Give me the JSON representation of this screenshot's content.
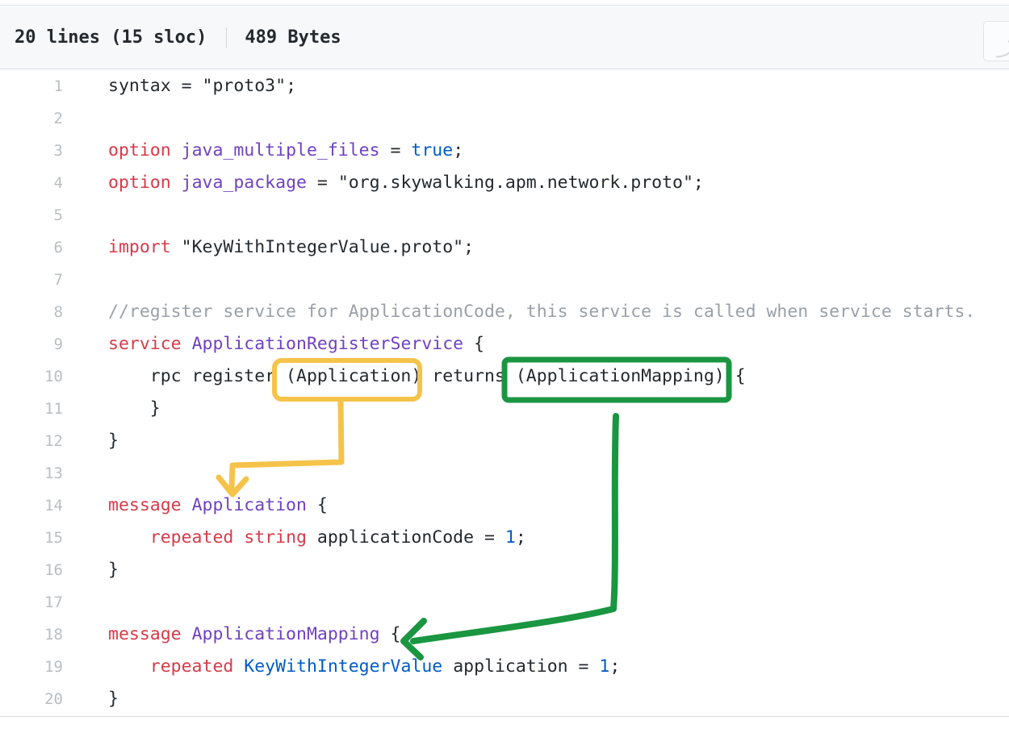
{
  "header": {
    "lines_label": "20 lines (15 sloc)",
    "bytes_label": "489 Bytes",
    "action_glyph": "⤴"
  },
  "code": {
    "language": "protobuf",
    "lines": [
      {
        "n": "1",
        "tokens": [
          {
            "t": "syntax",
            "c": "p"
          },
          {
            "t": " = ",
            "c": "p"
          },
          {
            "t": "\"proto3\"",
            "c": "s"
          },
          {
            "t": ";",
            "c": "p"
          }
        ]
      },
      {
        "n": "2",
        "tokens": []
      },
      {
        "n": "3",
        "tokens": [
          {
            "t": "option",
            "c": "k"
          },
          {
            "t": " ",
            "c": "p"
          },
          {
            "t": "java_multiple_files",
            "c": "n"
          },
          {
            "t": " = ",
            "c": "p"
          },
          {
            "t": "true",
            "c": "nb"
          },
          {
            "t": ";",
            "c": "p"
          }
        ]
      },
      {
        "n": "4",
        "tokens": [
          {
            "t": "option",
            "c": "k"
          },
          {
            "t": " ",
            "c": "p"
          },
          {
            "t": "java_package",
            "c": "n"
          },
          {
            "t": " = ",
            "c": "p"
          },
          {
            "t": "\"org.skywalking.apm.network.proto\"",
            "c": "s"
          },
          {
            "t": ";",
            "c": "p"
          }
        ]
      },
      {
        "n": "5",
        "tokens": []
      },
      {
        "n": "6",
        "tokens": [
          {
            "t": "import",
            "c": "k"
          },
          {
            "t": " ",
            "c": "p"
          },
          {
            "t": "\"KeyWithIntegerValue.proto\"",
            "c": "s"
          },
          {
            "t": ";",
            "c": "p"
          }
        ]
      },
      {
        "n": "7",
        "tokens": []
      },
      {
        "n": "8",
        "tokens": [
          {
            "t": "//register service for ApplicationCode, this service is called when service starts.",
            "c": "c"
          }
        ]
      },
      {
        "n": "9",
        "tokens": [
          {
            "t": "service",
            "c": "k"
          },
          {
            "t": " ",
            "c": "p"
          },
          {
            "t": "ApplicationRegisterService",
            "c": "n"
          },
          {
            "t": " {",
            "c": "p"
          }
        ]
      },
      {
        "n": "10",
        "tokens": [
          {
            "t": "    rpc register (Application) returns (ApplicationMapping) {",
            "c": "p"
          }
        ]
      },
      {
        "n": "11",
        "tokens": [
          {
            "t": "    }",
            "c": "p"
          }
        ]
      },
      {
        "n": "12",
        "tokens": [
          {
            "t": "}",
            "c": "p"
          }
        ]
      },
      {
        "n": "13",
        "tokens": []
      },
      {
        "n": "14",
        "tokens": [
          {
            "t": "message",
            "c": "k"
          },
          {
            "t": " ",
            "c": "p"
          },
          {
            "t": "Application",
            "c": "n"
          },
          {
            "t": " {",
            "c": "p"
          }
        ]
      },
      {
        "n": "15",
        "tokens": [
          {
            "t": "    ",
            "c": "p"
          },
          {
            "t": "repeated",
            "c": "k"
          },
          {
            "t": " ",
            "c": "p"
          },
          {
            "t": "string",
            "c": "k"
          },
          {
            "t": " applicationCode = ",
            "c": "p"
          },
          {
            "t": "1",
            "c": "num"
          },
          {
            "t": ";",
            "c": "p"
          }
        ]
      },
      {
        "n": "16",
        "tokens": [
          {
            "t": "}",
            "c": "p"
          }
        ]
      },
      {
        "n": "17",
        "tokens": []
      },
      {
        "n": "18",
        "tokens": [
          {
            "t": "message",
            "c": "k"
          },
          {
            "t": " ",
            "c": "p"
          },
          {
            "t": "ApplicationMapping",
            "c": "n"
          },
          {
            "t": " {",
            "c": "p"
          }
        ]
      },
      {
        "n": "19",
        "tokens": [
          {
            "t": "    ",
            "c": "p"
          },
          {
            "t": "repeated",
            "c": "k"
          },
          {
            "t": " ",
            "c": "p"
          },
          {
            "t": "KeyWithIntegerValue",
            "c": "nb"
          },
          {
            "t": " application = ",
            "c": "p"
          },
          {
            "t": "1",
            "c": "num"
          },
          {
            "t": ";",
            "c": "p"
          }
        ]
      },
      {
        "n": "20",
        "tokens": [
          {
            "t": "}",
            "c": "p"
          }
        ]
      }
    ]
  },
  "annotations": {
    "yellow": {
      "color": "#f5c34a",
      "highlighted_text": "(Application)",
      "target_text": "message Application",
      "shape": "rounded-box-with-elbow-arrow"
    },
    "green": {
      "color": "#1a9641",
      "highlighted_text": "(ApplicationMapping)",
      "target_text": "message ApplicationMapping",
      "shape": "rounded-box-with-elbow-arrow"
    }
  },
  "colors": {
    "keyword": "#d73a49",
    "type_name": "#6f42c1",
    "builtin": "#005cc5",
    "comment": "#9aa0a6",
    "number": "#005cc5",
    "text": "#24292e",
    "line_number": "#b9bec4",
    "header_bg": "#f6f8fa",
    "border": "#d8dce1"
  }
}
